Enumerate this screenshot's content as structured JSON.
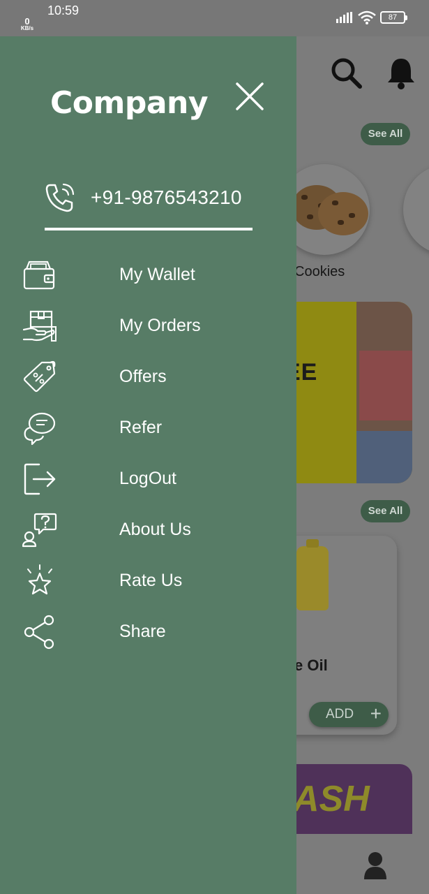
{
  "status_bar": {
    "time": "10:59",
    "net_speed_value": "0",
    "net_speed_unit": "KB/s",
    "battery": "87"
  },
  "drawer": {
    "title": "Company",
    "phone": "+91-9876543210",
    "menu": [
      {
        "label": "My Wallet",
        "icon": "wallet-icon"
      },
      {
        "label": "My Orders",
        "icon": "orders-box-icon"
      },
      {
        "label": "Offers",
        "icon": "offer-tag-icon"
      },
      {
        "label": "Refer",
        "icon": "refer-chat-icon"
      },
      {
        "label": "LogOut",
        "icon": "logout-icon"
      },
      {
        "label": "About Us",
        "icon": "about-question-icon"
      },
      {
        "label": "Rate Us",
        "icon": "star-icon"
      },
      {
        "label": "Share",
        "icon": "share-icon"
      }
    ]
  },
  "background_app": {
    "see_all_1": "See All",
    "see_all_2": "See All",
    "category_label": "Cookies",
    "banner_text": "EE",
    "product_name": "e Oil",
    "add_label": "ADD",
    "banner2_text": "ASH"
  },
  "colors": {
    "drawer_bg": "#577c66",
    "accent": "#3e5c48",
    "overlay": "#7c7c7c"
  }
}
